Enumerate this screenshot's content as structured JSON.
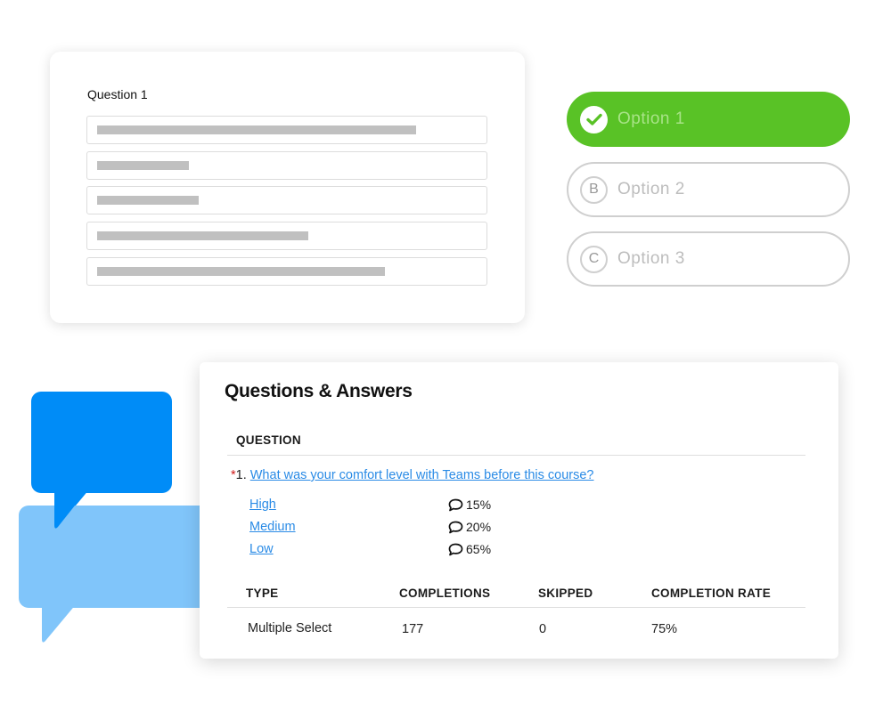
{
  "question_card": {
    "title": "Question 1",
    "placeholder_fields": [
      {
        "fill": 0.8
      },
      {
        "fill": 0.23
      },
      {
        "fill": 0.255
      },
      {
        "fill": 0.53
      },
      {
        "fill": 0.72
      }
    ]
  },
  "options": [
    {
      "label": "Option 1",
      "badge": "check",
      "selected": true
    },
    {
      "label": "Option 2",
      "badge": "B",
      "selected": false
    },
    {
      "label": "Option 3",
      "badge": "C",
      "selected": false
    }
  ],
  "colors": {
    "selected_green": "#59c226",
    "link_blue": "#2a8be6",
    "bubble_dark_blue": "#008cf7",
    "bubble_light_blue": "#80c5fa",
    "required_red": "#d11a1a"
  },
  "qa": {
    "title": "Questions & Answers",
    "question_header": "QUESTION",
    "question": {
      "required_mark": "*",
      "number": "1.",
      "text": "What was your comfort level with Teams before this course?"
    },
    "answers": [
      {
        "label": "High",
        "percent": "15%"
      },
      {
        "label": "Medium",
        "percent": "20%"
      },
      {
        "label": "Low",
        "percent": "65%"
      }
    ],
    "stats_headers": [
      "TYPE",
      "COMPLETIONS",
      "SKIPPED",
      "COMPLETION RATE"
    ],
    "stats_row": [
      "Multiple Select",
      "177",
      "0",
      "75%"
    ]
  }
}
